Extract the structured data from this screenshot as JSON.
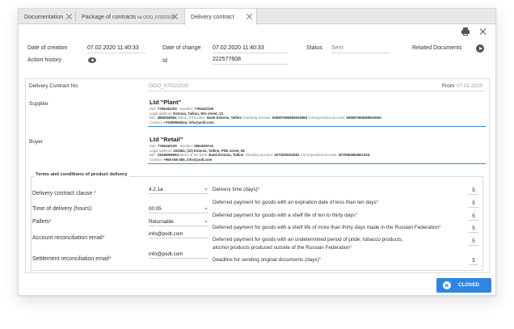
{
  "tabs": [
    {
      "label": "Documentation"
    },
    {
      "label": "Package of contracts",
      "suffix": "№ OOO_0702/2020"
    },
    {
      "label": "Delivery contract"
    }
  ],
  "header": {
    "date_creation_label": "Date of creation",
    "date_creation_value": "07.02.2020 11:40:33",
    "date_change_label": "Date of change",
    "date_change_value": "07.02.2020 11:40:33",
    "status_label": "Status",
    "status_value": "Sent",
    "related_docs_label": "Related Documents",
    "history_label": "Action history",
    "id_label": "Id",
    "id_value": "222577608"
  },
  "contract": {
    "no_label": "Delivery Contract No.",
    "no_value": "OOO_0702/2020",
    "from_label": "From",
    "from_value": "07.02.2020"
  },
  "supplier": {
    "label": "Supplier",
    "name": "Ltd \"Plant\"",
    "inn_label": "INN:",
    "inn": "7765442109",
    "iec_label": "Sweden:",
    "iec": "7765442109",
    "addr_label": "Legal address:",
    "addr": "Estonia, Tallinn, Wis street, 13",
    "bic_label": "BIC:",
    "bic": "4869450964",
    "bank_label": "Name of the bank:",
    "bank": "Bank Estonia, Tallinn",
    "acc_label": "Checking account:",
    "acc": "94965766565653456d",
    "corr_label": "Correspondent account:",
    "corr": "94965766656565456d",
    "contact_label": "Contact:",
    "contact": "+79269956524, info@podt.com"
  },
  "buyer": {
    "label": "Buyer",
    "name": "Ltd \"Retail\"",
    "inn_label": "INN:",
    "inn": "7765442109",
    "iec_label": "Sweden:",
    "iec": "5954065741",
    "addr_label": "Legal address:",
    "addr": "203082, (22) Estonia, Tallinn, Pikk street, 58",
    "bic_label": "BIC:",
    "bic": "41846969664",
    "bank_label": "Name of the bank:",
    "bank": "Bank Estonia, Tallinn",
    "acc_label": "Checking account:",
    "acc": "40702061546d1",
    "corr_label": "Correspondent account:",
    "corr": "307066495465132d",
    "contact_label": "Contact:",
    "contact": "+958 555 585, info@podt.com"
  },
  "terms": {
    "title": "Terms and conditions of product delivery",
    "left": [
      {
        "label": "Delivery contract clause",
        "req": "*",
        "value": "4.2.1a",
        "dropdown": true
      },
      {
        "label": "Time of delivery (hours)",
        "req": "",
        "value": "00:05",
        "dropdown": true
      },
      {
        "label": "Pallets",
        "req": "*",
        "value": "Returnable",
        "dropdown": true
      },
      {
        "label": "Account reconciliation email",
        "req": "*",
        "value": "info@podt.com",
        "dropdown": false
      },
      {
        "label": "Settlement reconciliation email",
        "req": "*",
        "value": "info@podt.com",
        "dropdown": false
      }
    ],
    "right": [
      {
        "label": "Delivery time (days)",
        "req": "*",
        "value": "5"
      },
      {
        "label": "Deferred payment for goods with an expiration date of less than ten days",
        "req": "*",
        "value": "5"
      },
      {
        "label": "Deferred payment for goods with a shelf life of ten to thirty days",
        "req": "*",
        "value": "5"
      },
      {
        "label": "Deferred payment for goods with a shelf life of more than thirty days made in the Russian Federation",
        "req": "*",
        "value": "5"
      },
      {
        "label": "Deferred payment for goods with an undetermined period of pride, tobacco products,",
        "req": "",
        "value": "5"
      },
      {
        "label": "alcohol products produced outside of the Russian Federation",
        "req": "*",
        "value": ""
      },
      {
        "label": "Deadline for sending original documents (days)",
        "req": "*",
        "value": "5"
      }
    ]
  },
  "footer": {
    "closed_label": "CLOSED"
  },
  "colors": {
    "accent": "#2f86e0",
    "link": "#3d8bd8"
  }
}
